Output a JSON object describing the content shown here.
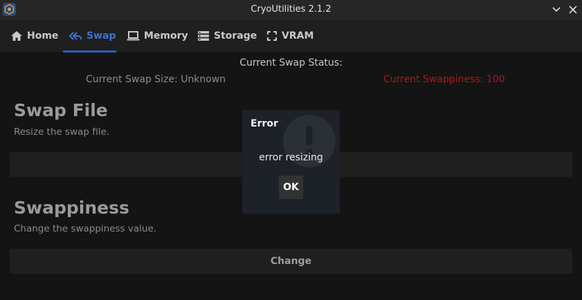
{
  "window": {
    "title": "CryoUtilities 2.1.2"
  },
  "tabs": [
    {
      "label": "Home",
      "icon": "home-icon"
    },
    {
      "label": "Swap",
      "icon": "swap-icon",
      "active": true
    },
    {
      "label": "Memory",
      "icon": "laptop-icon"
    },
    {
      "label": "Storage",
      "icon": "storage-icon"
    },
    {
      "label": "VRAM",
      "icon": "fullscreen-icon"
    }
  ],
  "status": {
    "heading": "Current Swap Status:",
    "swap_size": "Current Swap Size: Unknown",
    "swappiness": "Current Swappiness: 100"
  },
  "swap_file": {
    "title": "Swap File",
    "description": "Resize the swap file.",
    "button_label": ""
  },
  "swappiness_section": {
    "title": "Swappiness",
    "description": "Change the swappiness value.",
    "button_label": "Change"
  },
  "dialog": {
    "title": "Error",
    "message": "error resizing",
    "ok_label": "OK",
    "icon": "warning-icon"
  },
  "colors": {
    "accent": "#3b73d9",
    "error": "#b01717",
    "background": "#141414"
  }
}
